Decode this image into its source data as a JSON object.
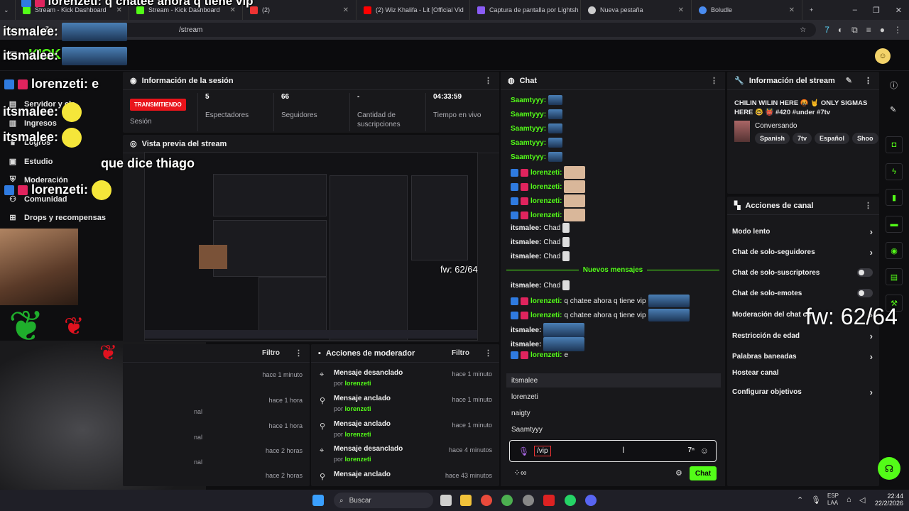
{
  "browser": {
    "tabs": [
      {
        "label": "Stream - Kick Dashboard",
        "color": "#53fc18"
      },
      {
        "label": "Stream - Kick Dashboard",
        "color": "#53fc18"
      },
      {
        "label": "(2)",
        "color": "#e33"
      },
      {
        "label": "(2) Wiz Khalifa - Lit [Official Vid",
        "color": "#f00"
      },
      {
        "label": "Captura de pantalla por Lightsh",
        "color": "#8a5cf6"
      },
      {
        "label": "Nueva pestaña",
        "color": "#ccc"
      },
      {
        "label": "Boludle",
        "color": "#4a8cf0"
      }
    ],
    "url": "/stream"
  },
  "sidebar": {
    "items": [
      {
        "label": "Servidor y cla",
        "icon": "server-icon"
      },
      {
        "label": "Ingresos",
        "icon": "chart-icon"
      },
      {
        "label": "Logros",
        "icon": "trophy-icon"
      },
      {
        "label": "Estudio",
        "icon": "studio-icon"
      },
      {
        "label": "Moderación",
        "icon": "shield-icon"
      },
      {
        "label": "Comunidad",
        "icon": "community-icon"
      },
      {
        "label": "Drops y recompensas",
        "icon": "gift-icon"
      }
    ]
  },
  "session": {
    "title": "Información de la sesión",
    "badge": "TRANSMITIENDO",
    "session_label": "Sesión",
    "stats": [
      {
        "value": "5",
        "label": "Espectadores"
      },
      {
        "value": "66",
        "label": "Seguidores"
      },
      {
        "value": "-",
        "label": "Cantidad de suscripciones"
      },
      {
        "value": "04:33:59",
        "label": "Tiempo en vivo"
      }
    ]
  },
  "preview": {
    "title": "Vista previa del stream"
  },
  "feed": {
    "filter": "Filtro",
    "rows": [
      {
        "time": "hace 1 minuto",
        "frag": ""
      },
      {
        "time": "hace 1 hora",
        "frag": "nal"
      },
      {
        "time": "hace 1 hora",
        "frag": "nal"
      },
      {
        "time": "hace 2 horas",
        "frag": "nal"
      },
      {
        "time": "hace 2 horas",
        "frag": ""
      }
    ]
  },
  "mod_actions": {
    "title": "Acciones de moderador",
    "filter": "Filtro",
    "by_prefix": "por",
    "rows": [
      {
        "action": "Mensaje desanclado",
        "user": "lorenzeti",
        "time": "hace 1 minuto"
      },
      {
        "action": "Mensaje anclado",
        "user": "lorenzeti",
        "time": "hace 1 minuto"
      },
      {
        "action": "Mensaje anclado",
        "user": "lorenzeti",
        "time": "hace 1 minuto"
      },
      {
        "action": "Mensaje desanclado",
        "user": "lorenzeti",
        "time": "hace 4 minutos"
      },
      {
        "action": "Mensaje anclado",
        "user": "",
        "time": "hace 43 minutos"
      }
    ]
  },
  "chat": {
    "title": "Chat",
    "new_messages": "Nuevos mensajes",
    "messages": [
      {
        "user": "Saamtyyy:",
        "color": "#53fc18",
        "text": "",
        "badges": 0
      },
      {
        "user": "Saamtyyy:",
        "color": "#53fc18",
        "text": "",
        "badges": 0
      },
      {
        "user": "Saamtyyy:",
        "color": "#53fc18",
        "text": "",
        "badges": 0
      },
      {
        "user": "Saamtyyy:",
        "color": "#53fc18",
        "text": "",
        "badges": 0
      },
      {
        "user": "Saamtyyy:",
        "color": "#53fc18",
        "text": "",
        "badges": 0
      },
      {
        "user": "lorenzeti:",
        "color": "#53fc18",
        "text": "",
        "badges": 2
      },
      {
        "user": "lorenzeti:",
        "color": "#53fc18",
        "text": "",
        "badges": 2
      },
      {
        "user": "lorenzeti:",
        "color": "#53fc18",
        "text": "",
        "badges": 2
      },
      {
        "user": "lorenzeti:",
        "color": "#53fc18",
        "text": "",
        "badges": 2
      },
      {
        "user": "itsmalee:",
        "color": "#f0f0f0",
        "text": "Chad",
        "badges": 0
      },
      {
        "user": "itsmalee:",
        "color": "#f0f0f0",
        "text": "Chad",
        "badges": 0
      },
      {
        "user": "itsmalee:",
        "color": "#f0f0f0",
        "text": "Chad",
        "badges": 0
      }
    ],
    "new_block": [
      {
        "user": "itsmalee:",
        "color": "#f0f0f0",
        "text": "Chad",
        "badges": 0
      },
      {
        "user": "lorenzeti:",
        "color": "#53fc18",
        "text": "q chatee ahora q tiene vip",
        "badges": 2
      },
      {
        "user": "lorenzeti:",
        "color": "#53fc18",
        "text": "q chatee ahora q tiene vip",
        "badges": 2
      },
      {
        "user": "itsmalee:",
        "color": "#f0f0f0",
        "text": "",
        "badges": 0
      },
      {
        "user": "itsmalee:",
        "color": "#f0f0f0",
        "text": "",
        "badges": 0
      },
      {
        "user": "lorenzeti:",
        "color": "#53fc18",
        "text": "e",
        "badges": 2
      }
    ],
    "suggestions": [
      "itsmalee",
      "lorenzeti",
      "naigty",
      "Saamtyyy"
    ],
    "input_value": "/vip",
    "send_label": "Chat"
  },
  "stream_info": {
    "title": "Información del stream",
    "stream_title": "CHILIN WILIN HERE 🤬 🤘 ONLY SIGMAS HERE 🤓 👹 #420 #under #7tv",
    "category": "Conversando",
    "tags": [
      "Spanish",
      "7tv",
      "Español",
      "Shoo"
    ]
  },
  "channel_actions": {
    "title": "Acciones de canal",
    "rows": [
      {
        "label": "Modo lento",
        "control": "chevron"
      },
      {
        "label": "Chat de solo-seguidores",
        "control": "chevron"
      },
      {
        "label": "Chat de solo-suscriptores",
        "control": "toggle"
      },
      {
        "label": "Chat de solo-emotes",
        "control": "toggle"
      },
      {
        "label": "Moderación del chat co",
        "control": "chevron"
      },
      {
        "label": "Restricción de edad",
        "control": "chevron"
      },
      {
        "label": "Palabras baneadas",
        "control": "chevron"
      },
      {
        "label": "Hostear canal",
        "control": "none"
      },
      {
        "label": "Configurar objetivos",
        "control": "chevron"
      }
    ]
  },
  "overlays": {
    "top_msg": {
      "user": "lorenzeti:",
      "text": "q chatee ahora q tiene vip"
    },
    "itsmalee1": "itsmalee:",
    "itsmalee2": "itsmalee:",
    "lorenzeti_e": {
      "user": "lorenzeti:",
      "text": "e"
    },
    "itsmalee3": "itsmalee:",
    "itsmalee4": "itsmalee:",
    "dice": "que dice thiago",
    "lorenzeti_last": "lorenzeti:",
    "fw_small": "fw: 62/64",
    "fw_big": "fw: 62/64",
    "kick_partial": "KICK"
  },
  "taskbar": {
    "search_placeholder": "Buscar",
    "lang": "ESP\nLAA",
    "time": "22:44",
    "date": "22/2/2026"
  },
  "colors": {
    "accent": "#53fc18",
    "live": "#e9141b",
    "panel": "#18181b",
    "bg": "#0e0e10"
  }
}
